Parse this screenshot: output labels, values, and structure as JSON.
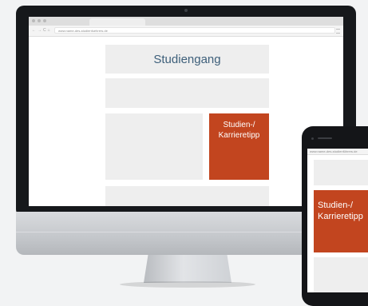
{
  "browser": {
    "url": "www.name-des-studienfuehrers.de",
    "nav_icons": [
      "back-arrow",
      "forward-arrow",
      "reload",
      "home"
    ]
  },
  "page": {
    "title": "Studiengang",
    "tipp_line1": "Studien-/",
    "tipp_line2": "Karrieretipp"
  },
  "phone": {
    "url": "www.name-des-studienführers.de",
    "tipp_line1": "Studien-/",
    "tipp_line2": "Karrieretipp"
  },
  "colors": {
    "accent": "#c2451f",
    "title": "#3d5f7a",
    "placeholder": "#eeeeee"
  }
}
